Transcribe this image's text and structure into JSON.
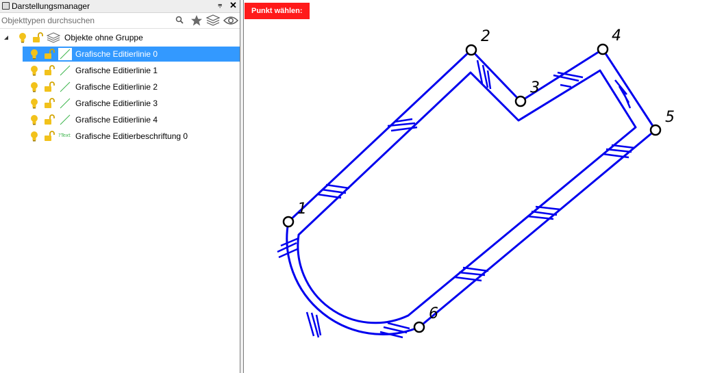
{
  "panel": {
    "title": "Darstellungsmanager",
    "pin_symbol": "⩦",
    "close_symbol": "✕",
    "search": {
      "placeholder": "Objekttypen durchsuchen",
      "value": ""
    },
    "toolbar_icons": [
      "search-icon",
      "star-icon",
      "layers-icon",
      "eye-icon"
    ]
  },
  "tree": {
    "group": {
      "label": "Objekte ohne Gruppe",
      "expanded": true
    },
    "items": [
      {
        "label": "Grafische Editierlinie 0",
        "type": "line",
        "selected": true
      },
      {
        "label": "Grafische Editierlinie 1",
        "type": "line",
        "selected": false
      },
      {
        "label": "Grafische Editierlinie 2",
        "type": "line",
        "selected": false
      },
      {
        "label": "Grafische Editierlinie 3",
        "type": "line",
        "selected": false
      },
      {
        "label": "Grafische Editierlinie 4",
        "type": "line",
        "selected": false
      },
      {
        "label": "Grafische Editierbeschriftung 0",
        "type": "text",
        "selected": false
      }
    ],
    "text_icon_label": "?Text"
  },
  "canvas": {
    "prompt": "Punkt wählen:",
    "point_labels": [
      "1",
      "2",
      "3",
      "4",
      "5",
      "6"
    ]
  },
  "colors": {
    "selection": "#3399ff",
    "prompt_bg": "#ff1a1a",
    "drawing_line": "#0000ee",
    "bulb": "#f2c21b",
    "lock": "#f2c21b",
    "line_icon": "#3cb44b"
  }
}
